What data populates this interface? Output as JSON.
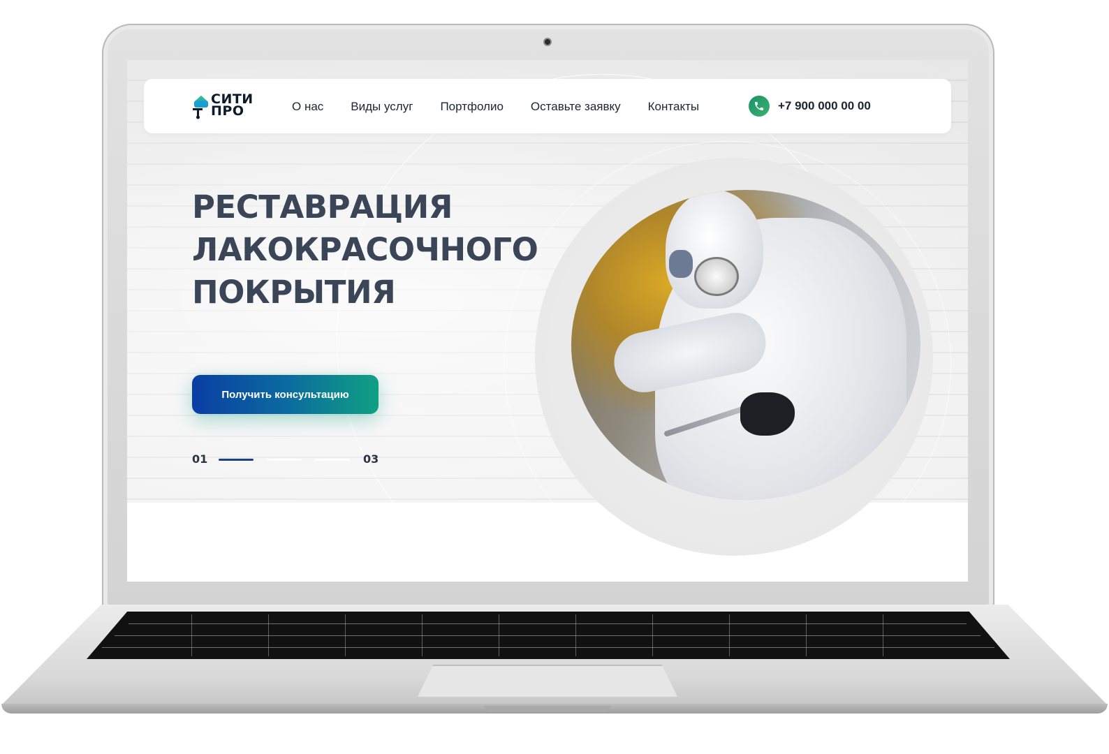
{
  "logo": {
    "line1": "СИТИ",
    "line2": "ПРО"
  },
  "nav": {
    "items": [
      {
        "label": "О нас"
      },
      {
        "label": "Виды услуг"
      },
      {
        "label": "Портфолио"
      },
      {
        "label": "Оставьте заявку"
      },
      {
        "label": "Контакты"
      }
    ]
  },
  "phone": {
    "number": "+7 900 000 00 00",
    "icon": "phone-icon"
  },
  "hero": {
    "title_lines": [
      "РЕСТАВРАЦИЯ",
      "ЛАКОКРАСОЧНОГО",
      "ПОКРЫТИЯ"
    ],
    "cta_label": "Получить консультацию"
  },
  "slider": {
    "start": "01",
    "end": "03",
    "active_index": 0,
    "total": 3
  },
  "colors": {
    "title": "#3a4558",
    "cta_start": "#0a3ea3",
    "cta_end": "#10a083",
    "slider_active": "#1b3f8f",
    "phone_icon_bg": "#1a8f6e"
  }
}
